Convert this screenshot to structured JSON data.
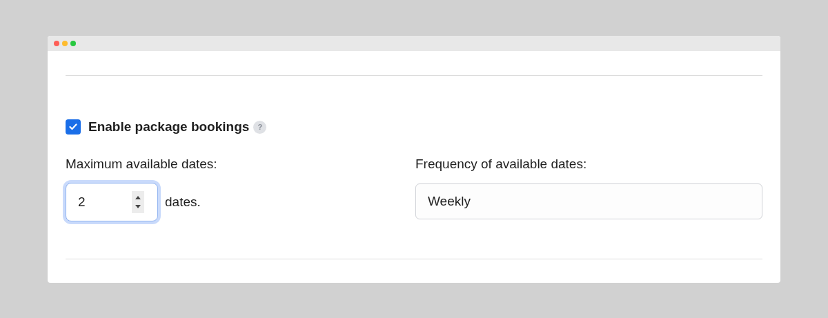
{
  "enable_package_bookings": {
    "label": "Enable package bookings",
    "checked": true,
    "help": "?"
  },
  "maximum_available_dates": {
    "label": "Maximum available dates:",
    "value": "2",
    "focused": true,
    "suffix": "dates."
  },
  "frequency_of_available_dates": {
    "label": "Frequency of available dates:",
    "value": "Weekly"
  }
}
